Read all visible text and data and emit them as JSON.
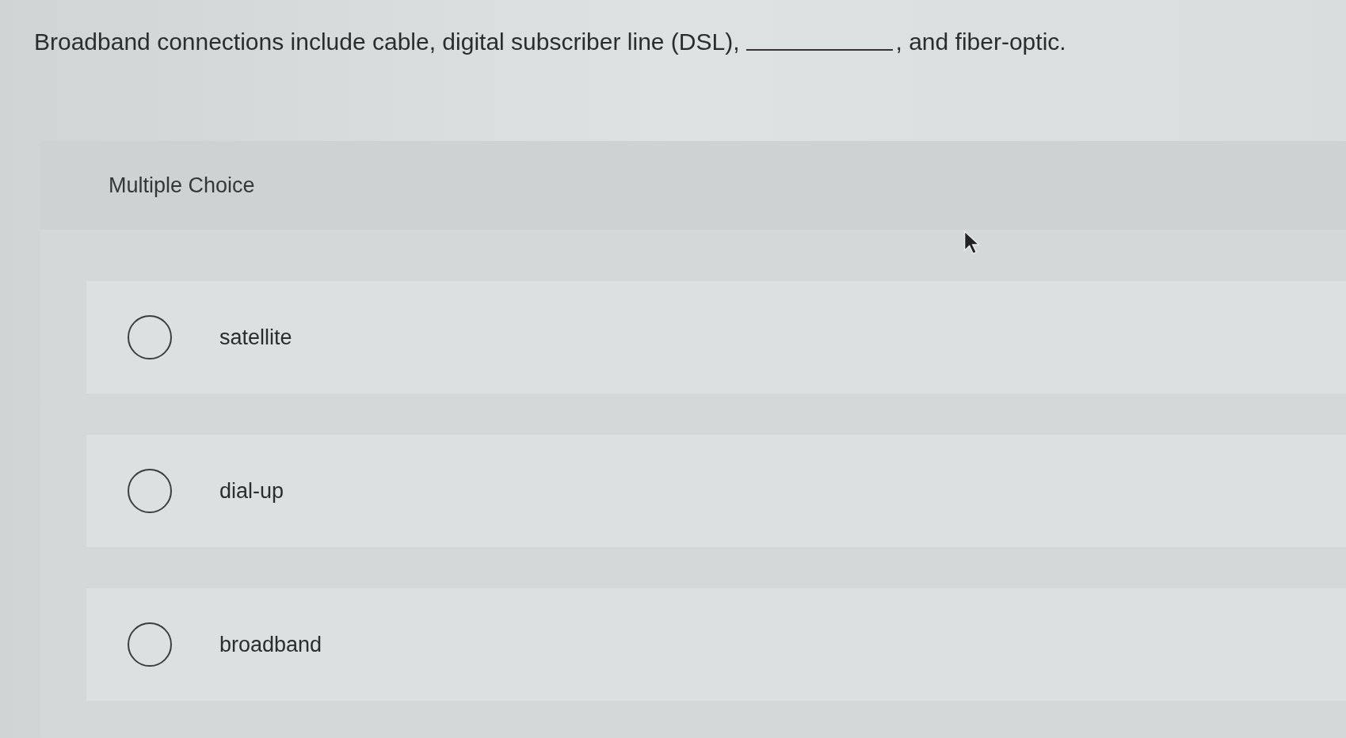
{
  "question": {
    "before": "Broadband connections include cable, digital subscriber line (DSL),",
    "after": ", and fiber-optic."
  },
  "section_title": "Multiple Choice",
  "options": [
    {
      "label": "satellite",
      "selected": false
    },
    {
      "label": "dial-up",
      "selected": false
    },
    {
      "label": "broadband",
      "selected": false
    }
  ]
}
